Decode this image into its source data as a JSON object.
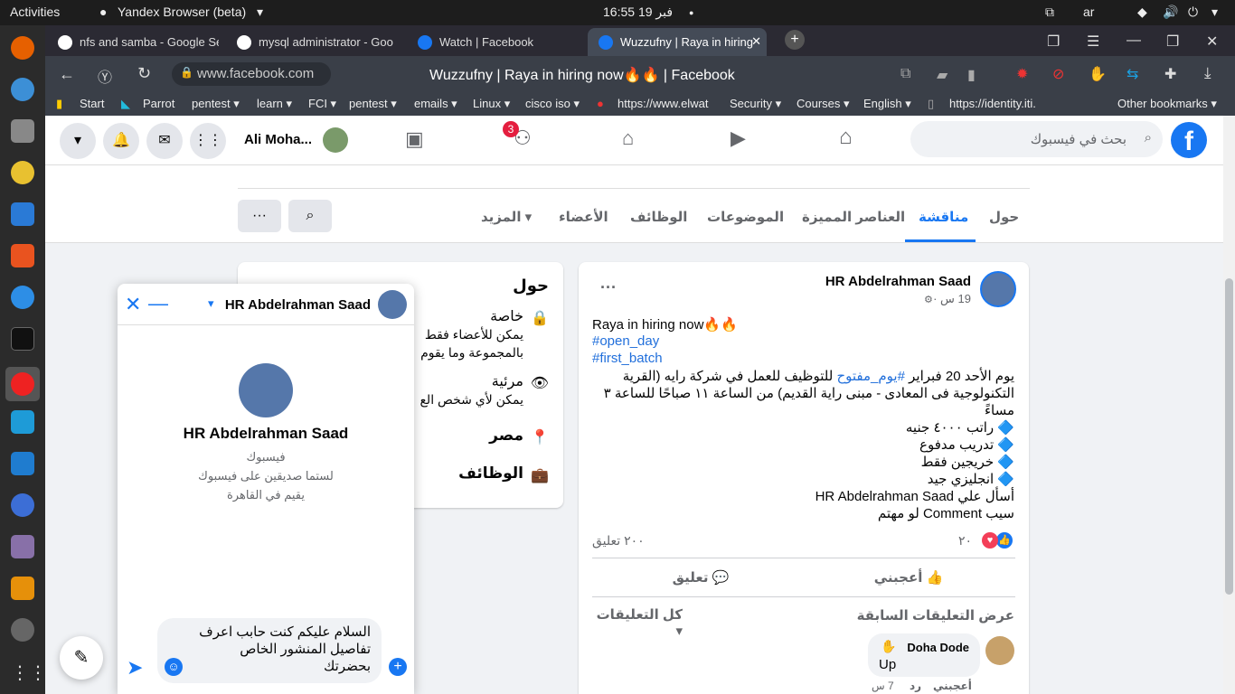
{
  "system_bar": {
    "activities": "Activities",
    "browser_name": "Yandex Browser (beta)",
    "clock": "16:55  فبر 19",
    "lang": "ar"
  },
  "tabs": [
    {
      "label": "nfs and samba - Google Se"
    },
    {
      "label": "mysql administrator - Goo"
    },
    {
      "label": "Watch | Facebook"
    },
    {
      "label": "Wuzzufny | Raya in hiring"
    }
  ],
  "address": {
    "url": "www.facebook.com",
    "page_title": "Wuzzufny | Raya in hiring now🔥🔥 | Facebook"
  },
  "bookmarks": [
    "Start",
    "Parrot",
    "pentest ▾",
    "learn ▾",
    "FCI ▾",
    "pentest ▾",
    "emails ▾",
    "Linux ▾",
    "cisco iso ▾",
    "https://www.elwat",
    "Security ▾",
    "Courses ▾",
    "English ▾",
    "https://identity.iti.",
    "Other bookmarks ▾"
  ],
  "fb_header": {
    "user_name": "Ali Moha...",
    "notif_count": "3",
    "search_placeholder": "بحث في فيسبوك"
  },
  "group_tabs": [
    "حول",
    "مناقشة",
    "العناصر المميزة",
    "الموضوعات",
    "الوظائف",
    "الأعضاء",
    "المزيد ▾"
  ],
  "about": {
    "title": "حول",
    "private_title": "خاصة",
    "private_desc1": "يمكن للأعضاء فقط",
    "private_desc2": "بالمجموعة وما يقوم",
    "visible_title": "مرئية",
    "visible_desc": "يمكن لأي شخص الع",
    "location": "مصر",
    "jobs": "الوظائف"
  },
  "post": {
    "author": "HR Abdelrahman Saad",
    "time": "19 س ·",
    "line1": "Raya in hiring now🔥🔥",
    "tag1": "#open_day",
    "tag2": "#first_batch",
    "body1_a": "يوم الأحد 20 فبراير",
    "body1_tag": "#يوم_مفتوح",
    "body1_b": "للتوظيف للعمل في شركة رايه (القرية",
    "body2": "التكنولوجية فى المعادى - مبنى راية القديم) من الساعة ١١ صباحًا للساعة ٣",
    "body3": "مساءً",
    "b1": "🔷 راتب ٤٠٠٠ جنيه",
    "b2": "🔷 تدريب مدفوع",
    "b3": "🔷 خريجين فقط",
    "b4": "🔷 انجليزي جيد",
    "ask": "أسأل علي  HR Abdelrahman Saad",
    "comment_line": "سيب Comment لو مهتم",
    "reactions": "٢٠",
    "comments_count": "٢٠٠ تعليق",
    "like": "أعجبني",
    "comment": "تعليق",
    "prev_comments": "عرض التعليقات السابقة",
    "all_comments": "كل التعليقات",
    "commenter": "Doha Dode",
    "comment_text": "Up",
    "c_like": "أعجبني",
    "c_reply": "رد",
    "c_time": "7 س"
  },
  "chat": {
    "name": "HR Abdelrahman Saad",
    "platform": "فيسبوك",
    "not_friends": "لستما صديقين على فيسبوك",
    "lives": "يقيم في القاهرة",
    "draft1": "السلام عليكم كنت حابب اعرف",
    "draft2": "تفاصيل المنشور  الخاص",
    "draft3": "بحضرتك"
  },
  "colors": {
    "fb_blue": "#1877f2",
    "accent": "#216fdb",
    "badge": "#e41e3f"
  }
}
